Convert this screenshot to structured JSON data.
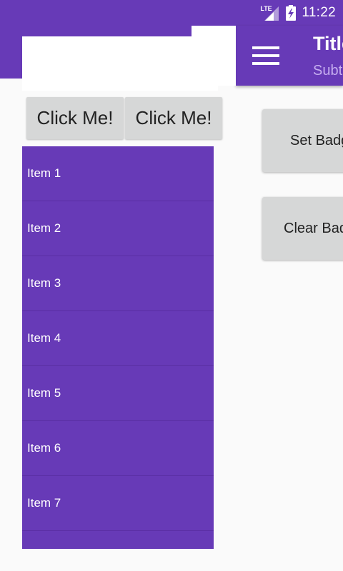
{
  "status_bar": {
    "network_label": "LTE",
    "time": "11:22",
    "colors": {
      "background": "#673ab7"
    }
  },
  "app_bar": {
    "title": "Title",
    "subtitle": "Subtitle",
    "menu_icon": "hamburger-menu-icon",
    "colors": {
      "background": "#673ab7",
      "subtitle": "#c6aef0"
    }
  },
  "drawer": {
    "buttons": [
      {
        "label": "Click Me!"
      },
      {
        "label": "Click Me!"
      }
    ],
    "items": [
      {
        "label": "Item 1"
      },
      {
        "label": "Item 2"
      },
      {
        "label": "Item 3"
      },
      {
        "label": "Item 4"
      },
      {
        "label": "Item 5"
      },
      {
        "label": "Item 6"
      },
      {
        "label": "Item 7"
      },
      {
        "label": ""
      }
    ],
    "colors": {
      "list_background": "#673ab7",
      "item_text": "#ffffff"
    }
  },
  "main": {
    "set_badge_label": "Set Badge",
    "clear_badge_label": "Clear Badge"
  }
}
